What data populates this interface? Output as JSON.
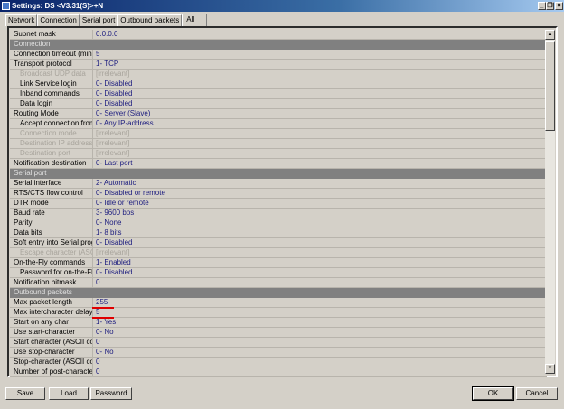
{
  "window": {
    "title": "Settings: DS <V3.31(S)>+N",
    "minimize": "_",
    "restore": "❐",
    "close": "×"
  },
  "tabs": [
    "Network",
    "Connection",
    "Serial port",
    "Outbound packets",
    "All"
  ],
  "rows": [
    {
      "label": "Subnet mask",
      "value": "0.0.0.0"
    },
    {
      "header": "Connection"
    },
    {
      "label": "Connection timeout (min)",
      "value": "5"
    },
    {
      "label": "Transport protocol",
      "value": "1- TCP"
    },
    {
      "label": "Broadcast UDP data",
      "value": "[irrelevant]",
      "indent": true,
      "disabled": true
    },
    {
      "label": "Link Service login",
      "value": "0- Disabled",
      "indent": true
    },
    {
      "label": "Inband commands",
      "value": "0- Disabled",
      "indent": true
    },
    {
      "label": "Data login",
      "value": "0- Disabled",
      "indent": true
    },
    {
      "label": "Routing Mode",
      "value": "0- Server (Slave)"
    },
    {
      "label": "Accept connection from",
      "value": "0- Any IP-address",
      "indent": true
    },
    {
      "label": "Connection mode",
      "value": "[irrelevant]",
      "indent": true,
      "disabled": true
    },
    {
      "label": "Destination IP address",
      "value": "[irrelevant]",
      "indent": true,
      "disabled": true
    },
    {
      "label": "Destination port",
      "value": "[irrelevant]",
      "indent": true,
      "disabled": true
    },
    {
      "label": "Notification destination",
      "value": "0- Last port"
    },
    {
      "header": "Serial port"
    },
    {
      "label": "Serial interface",
      "value": "2- Automatic"
    },
    {
      "label": "RTS/CTS flow control",
      "value": "0- Disabled or remote"
    },
    {
      "label": "DTR mode",
      "value": "0- Idle or remote"
    },
    {
      "label": "Baud rate",
      "value": "3- 9600 bps"
    },
    {
      "label": "Parity",
      "value": "0- None"
    },
    {
      "label": "Data bits",
      "value": "1- 8 bits"
    },
    {
      "label": "Soft entry into Serial programm",
      "value": "0- Disabled"
    },
    {
      "label": "Escape character (ASCII code)",
      "value": "[irrelevant]",
      "indent": true,
      "disabled": true
    },
    {
      "label": "On-the-Fly commands",
      "value": "1- Enabled"
    },
    {
      "label": "Password for on-the-Fly commands",
      "value": "0- Disabled",
      "indent": true
    },
    {
      "label": "Notification bitmask",
      "value": "0"
    },
    {
      "header": "Outbound packets"
    },
    {
      "label": "Max packet length",
      "value": "255",
      "marked": true
    },
    {
      "label": "Max intercharacter delay",
      "value": "5",
      "marked": true
    },
    {
      "label": "Start on any char",
      "value": "1- Yes"
    },
    {
      "label": "Use start-character",
      "value": "0- No"
    },
    {
      "label": "Start character (ASCII code)",
      "value": "0"
    },
    {
      "label": "Use stop-character",
      "value": "0- No"
    },
    {
      "label": "Stop-character (ASCII code)",
      "value": "0"
    },
    {
      "label": "Number of post-characters",
      "value": "0"
    }
  ],
  "buttons": {
    "save": "Save",
    "load": "Load",
    "password": "Password",
    "ok": "OK",
    "cancel": "Cancel"
  },
  "scroll": {
    "up": "▲",
    "down": "▼"
  }
}
